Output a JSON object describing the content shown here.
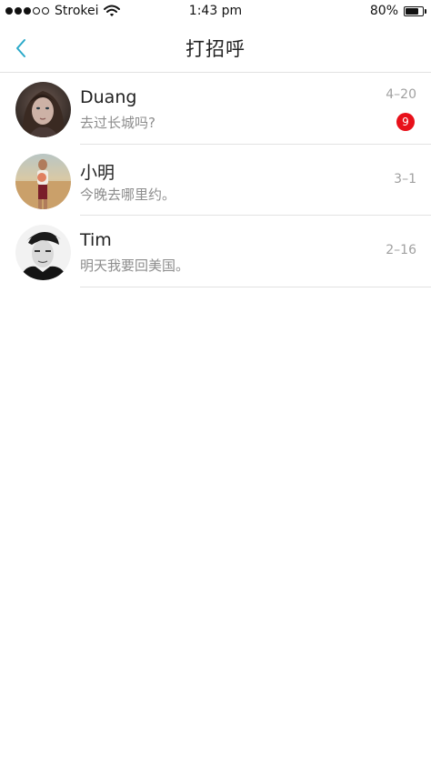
{
  "status_bar": {
    "carrier": "Strokei",
    "time": "1:43 pm",
    "battery": "80%",
    "signal_filled": 3,
    "signal_total": 5,
    "battery_level": 0.8
  },
  "nav": {
    "title": "打招呼",
    "back_icon": "chevron-left-icon",
    "accent_color": "#2aa9c9"
  },
  "conversations": [
    {
      "name": "Duang",
      "preview": "去过长城吗?",
      "date": "4–20",
      "unread": "9"
    },
    {
      "name": "小明",
      "preview": "今晚去哪里约。",
      "date": "3–1"
    },
    {
      "name": "Tim",
      "preview": "明天我要回美国。",
      "date": "2–16"
    }
  ],
  "colors": {
    "badge": "#e8101a",
    "divider": "#e2e2e2",
    "secondary_text": "#8d8d8d"
  }
}
